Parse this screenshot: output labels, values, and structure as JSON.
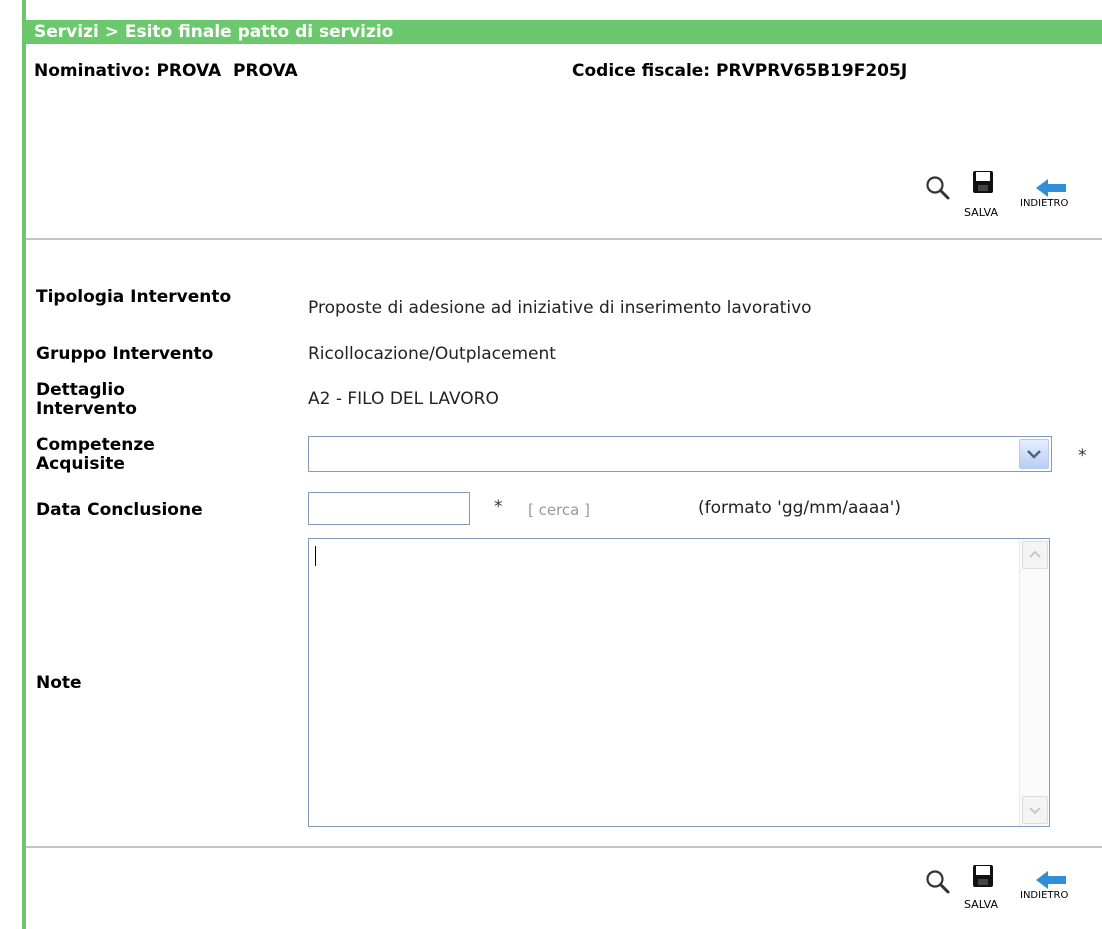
{
  "breadcrumb": "Servizi > Esito finale patto di servizio",
  "header": {
    "nominativo_label": "Nominativo:",
    "nominativo_value": "PROVA  PROVA",
    "cf_label": "Codice fiscale:",
    "cf_value": "PRVPRV65B19F205J"
  },
  "toolbar": {
    "save_label": "SALVA",
    "back_label": "INDIETRO"
  },
  "fields": {
    "tipologia_label": "Tipologia Intervento",
    "tipologia_value": "Proposte di adesione ad iniziative di inserimento lavorativo",
    "gruppo_label": "Gruppo Intervento",
    "gruppo_value": "Ricollocazione/Outplacement",
    "dettaglio_label": "Dettaglio Intervento",
    "dettaglio_value": "A2 - FILO DEL LAVORO",
    "competenze_label": "Competenze Acquisite",
    "competenze_value": "",
    "data_label": "Data Conclusione",
    "data_value": "",
    "required_mark": "*",
    "cerca_link": "[ cerca ]",
    "date_format_hint": "(formato 'gg/mm/aaaa')",
    "note_label": "Note",
    "note_value": ""
  },
  "colors": {
    "accent": "#6cc86c",
    "save_icon": "#111111",
    "back_arrow": "#2f8fd8"
  }
}
